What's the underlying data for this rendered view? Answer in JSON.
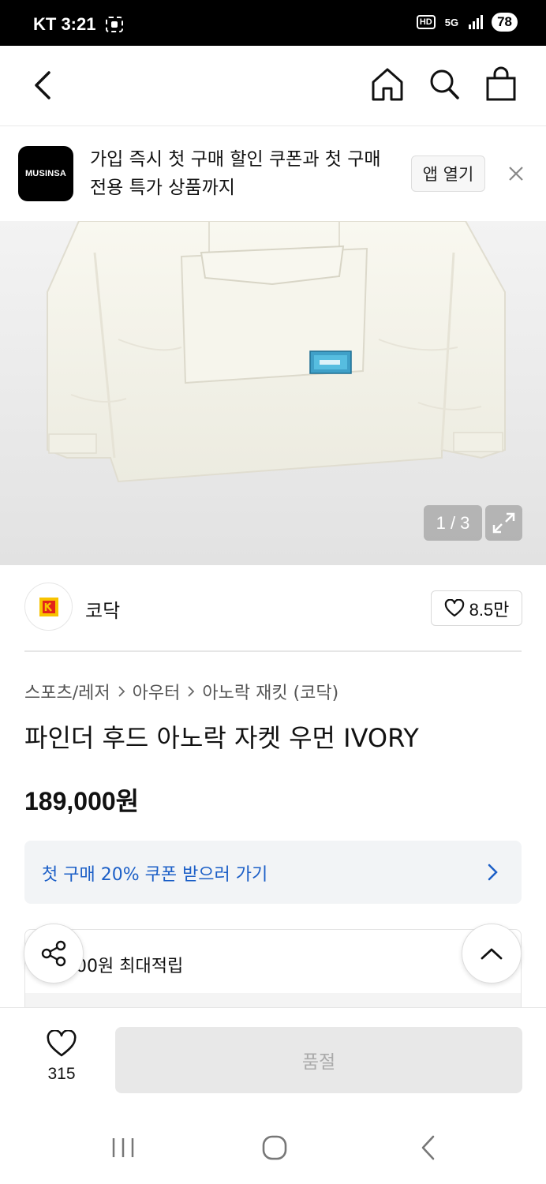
{
  "status_bar": {
    "carrier_time": "KT 3:21",
    "hd_badge": "HD",
    "net_badge": "5G",
    "battery": "78"
  },
  "banner": {
    "logo_text": "MUSINSA",
    "message": "가입 즉시 첫 구매 할인 쿠폰과 첫 구매 전용 특가 상품까지",
    "open_app_label": "앱 열기"
  },
  "gallery": {
    "pager": "1 / 3"
  },
  "brand": {
    "name": "코닥",
    "likes": "8.5만"
  },
  "breadcrumb": {
    "level1": "스포츠/레저",
    "level2": "아우터",
    "level3": "아노락 재킷 (코닥)"
  },
  "product": {
    "title": "파인더 후드 아노락 자켓 우먼 IVORY",
    "price": "189,000원"
  },
  "coupon": {
    "label": "첫 구매 20% 쿠폰 받으러 가기"
  },
  "points": {
    "label": "00원 최대적립"
  },
  "bottom": {
    "wish_count": "315",
    "soldout_label": "품절"
  },
  "colors": {
    "accent_blue": "#1c5fc7",
    "banner_black": "#000000",
    "kodak_red": "#e2231a",
    "kodak_yellow": "#f8c300"
  }
}
